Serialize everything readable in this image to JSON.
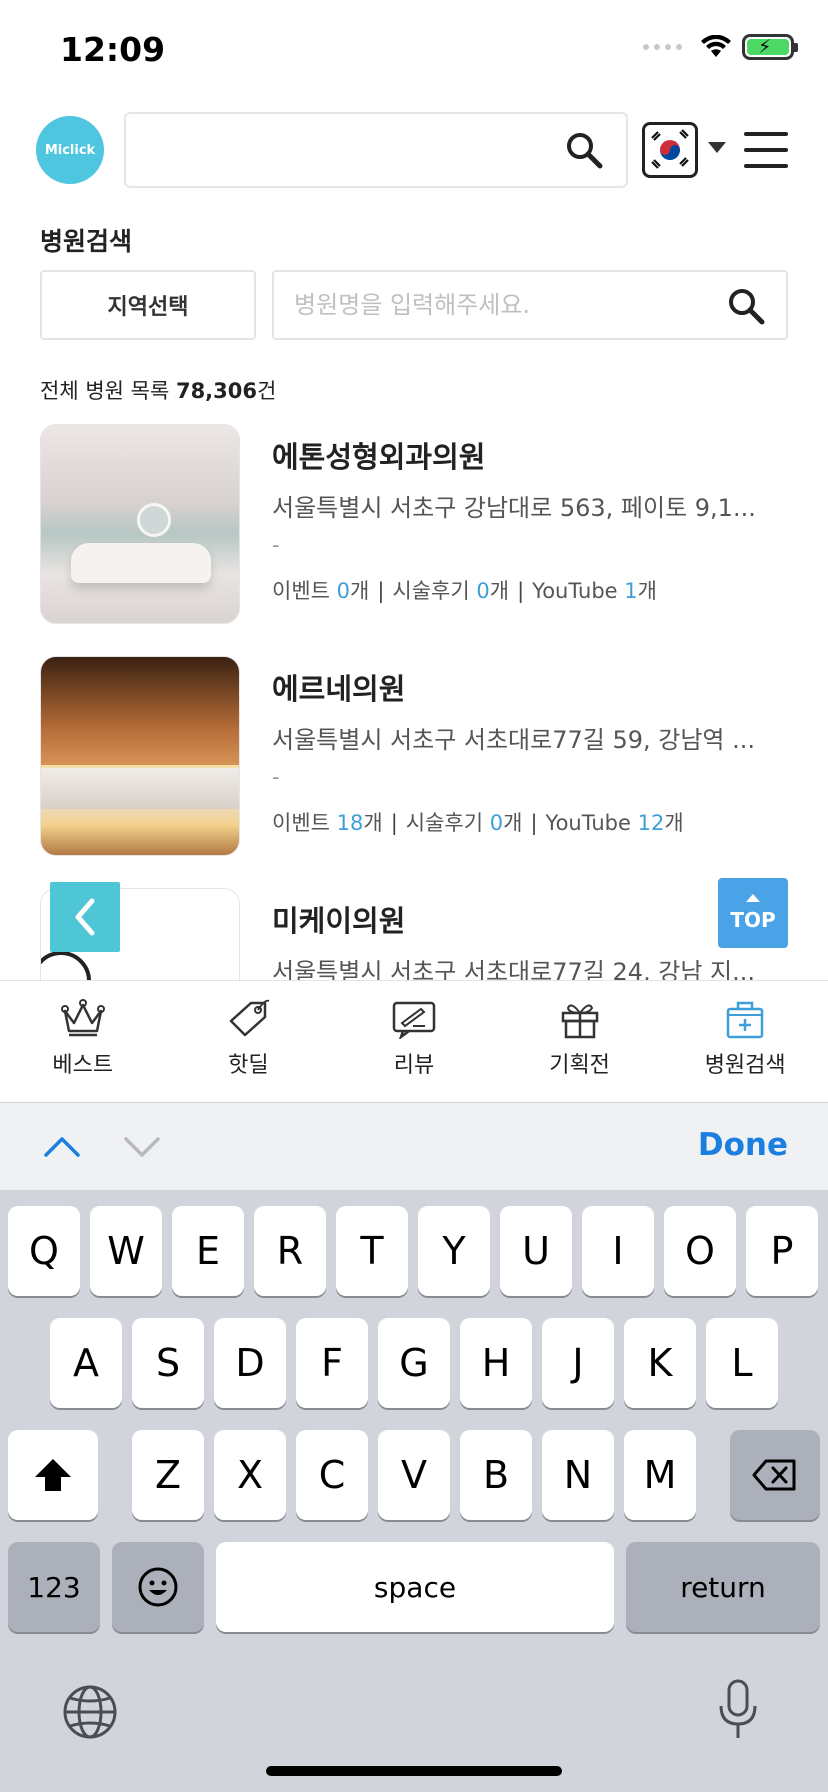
{
  "status": {
    "time": "12:09"
  },
  "header": {
    "logo_text": "Miclick",
    "search_placeholder": "",
    "flag": "korea-flag"
  },
  "section": {
    "title": "병원검색",
    "region_button": "지역선택",
    "search_placeholder": "병원명을 입력해주세요."
  },
  "total": {
    "prefix": "전체 병원 목록 ",
    "count": "78,306",
    "suffix": "건"
  },
  "hospitals": [
    {
      "name": "에톤성형외과의원",
      "address": "서울특별시 서초구 강남대로 563, 페이토 9,1...",
      "dash": "-",
      "event_label": "이벤트 ",
      "event_count": "0",
      "event_unit": "개",
      "review_label": "시술후기 ",
      "review_count": "0",
      "review_unit": "개",
      "youtube_label": "YouTube ",
      "youtube_count": "1",
      "youtube_unit": "개"
    },
    {
      "name": "에르네의원",
      "address": "서울특별시 서초구 서초대로77길 59, 강남역 ...",
      "dash": "-",
      "event_label": "이벤트 ",
      "event_count": "18",
      "event_unit": "개",
      "review_label": "시술후기 ",
      "review_count": "0",
      "review_unit": "개",
      "youtube_label": "YouTube ",
      "youtube_count": "12",
      "youtube_unit": "개"
    },
    {
      "name": "미케이의원",
      "address": "서울특별시 서초구 서초대로77길 24, 강남 지..."
    }
  ],
  "floating": {
    "top_label": "TOP"
  },
  "bottom_nav": [
    {
      "label": "베스트",
      "icon": "crown-icon"
    },
    {
      "label": "핫딜",
      "icon": "tag-icon"
    },
    {
      "label": "리뷰",
      "icon": "review-icon"
    },
    {
      "label": "기획전",
      "icon": "gift-icon"
    },
    {
      "label": "병원검색",
      "icon": "hospital-icon",
      "active": true
    }
  ],
  "keyboard": {
    "done": "Done",
    "row1": [
      "Q",
      "W",
      "E",
      "R",
      "T",
      "Y",
      "U",
      "I",
      "O",
      "P"
    ],
    "row2": [
      "A",
      "S",
      "D",
      "F",
      "G",
      "H",
      "J",
      "K",
      "L"
    ],
    "row3": [
      "Z",
      "X",
      "C",
      "V",
      "B",
      "N",
      "M"
    ],
    "numbers": "123",
    "space": "space",
    "return": "return"
  },
  "colors": {
    "accent": "#3e9fd8",
    "teal": "#4ec6d6",
    "done": "#1a7fe0"
  }
}
